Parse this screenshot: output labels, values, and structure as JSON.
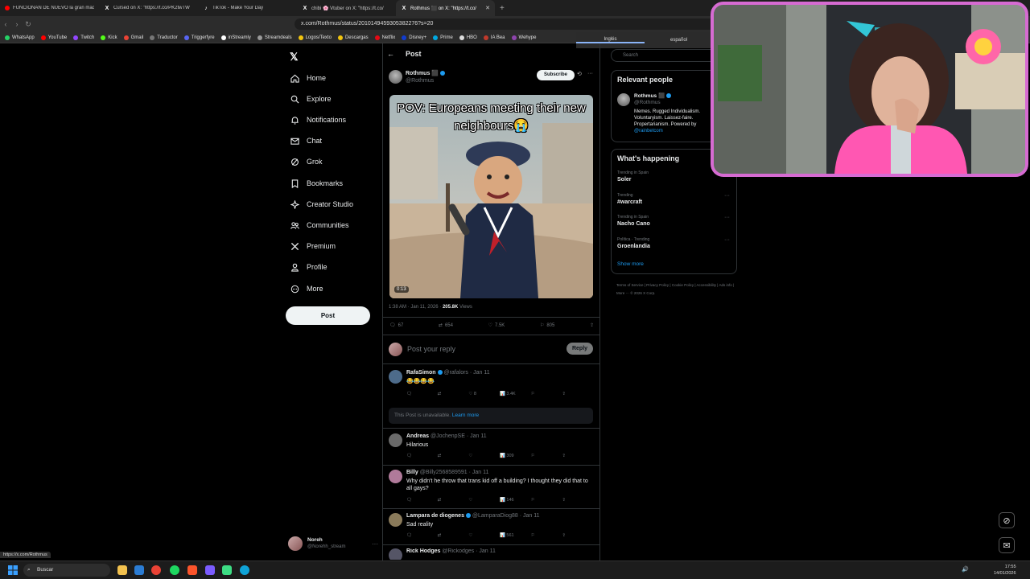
{
  "browser": {
    "tabs": [
      {
        "label": "FUNCIONAN DE NUEVO la gran maq",
        "icon": "youtube-icon",
        "active": false
      },
      {
        "label": "Cursed on X: \"https://t.co/PK2twTW",
        "icon": "x-icon",
        "active": false
      },
      {
        "label": "TikTok - Make Your Day",
        "icon": "tiktok-icon",
        "active": false
      },
      {
        "label": "chibi 🌸 Vtuber on X: \"https://t.co/",
        "icon": "x-icon",
        "active": false
      },
      {
        "label": "Rothmus ⬛ on X: \"https://t.co/",
        "icon": "x-icon",
        "active": true
      }
    ],
    "url": "x.com/Rothmus/status/2010149459305382276?s=20",
    "bookmarks": [
      "WhatsApp",
      "YouTube",
      "Twitch",
      "Kick",
      "Gmail",
      "Traductor",
      "Triggerfyre",
      "inStreamly",
      "Streamdeals",
      "Logos/Texto",
      "Descargas",
      "Netflix",
      "Disney+",
      "Prime",
      "HBO",
      "IA Bea",
      "Wehype"
    ],
    "translate": {
      "from": "Inglés",
      "to": "español"
    },
    "status_url": "https://x.com/Rothmus"
  },
  "x": {
    "logo": "𝕏",
    "nav": [
      {
        "label": "Home",
        "icon": "home-icon"
      },
      {
        "label": "Explore",
        "icon": "search-icon"
      },
      {
        "label": "Notifications",
        "icon": "bell-icon"
      },
      {
        "label": "Chat",
        "icon": "mail-icon"
      },
      {
        "label": "Grok",
        "icon": "grok-icon"
      },
      {
        "label": "Bookmarks",
        "icon": "bookmark-icon"
      },
      {
        "label": "Creator Studio",
        "icon": "creator-icon"
      },
      {
        "label": "Communities",
        "icon": "people-icon"
      },
      {
        "label": "Premium",
        "icon": "x-premium-icon"
      },
      {
        "label": "Profile",
        "icon": "person-icon"
      },
      {
        "label": "More",
        "icon": "more-icon"
      }
    ],
    "post_button": "Post",
    "account": {
      "name": "Noreh",
      "handle": "@Norehh_stream"
    }
  },
  "post": {
    "header": "Post",
    "author": {
      "name": "Rothmus ⬛",
      "handle": "@Rothmus"
    },
    "subscribe": "Subscribe",
    "video_caption": "POV: Europeans meeting their new neighbours😭",
    "duration": "0:13",
    "time": "1:38 AM · Jan 11, 2026 · ",
    "views": "205.8K",
    "views_label": " Views",
    "stats": {
      "replies": "67",
      "reposts": "654",
      "likes": "7.5K",
      "bookmarks": "805"
    },
    "reply_placeholder": "Post your reply",
    "reply_button": "Reply"
  },
  "replies": [
    {
      "name": "RafaSimon",
      "handle": "@rafalors · Jan 11",
      "text": "😂😂😂😂",
      "likes": "8",
      "views": "3.4K"
    },
    {
      "name": "Andreas",
      "handle": "@JochenpSE · Jan 11",
      "text": "Hilarious",
      "likes": "",
      "views": "309"
    },
    {
      "name": "Billy",
      "handle": "@Billy2568589591 · Jan 11",
      "text": "Why didn't he throw that trans kid off a building? I thought they did that to all gays?",
      "likes": "",
      "views": "146"
    },
    {
      "name": "Lampara de diogenes",
      "handle": "@LamparaDiog88 · Jan 11",
      "text": "Sad reality",
      "likes": "",
      "views": "561"
    },
    {
      "name": "Rick Hodges",
      "handle": "@Rickodges · Jan 11",
      "text": "",
      "likes": "",
      "views": ""
    }
  ],
  "unavailable": {
    "text": "This Post is unavailable. ",
    "link": "Learn more"
  },
  "sidebar": {
    "search_placeholder": "Search",
    "relevant_title": "Relevant people",
    "person": {
      "name": "Rothmus ⬛",
      "handle": "@Rothmus",
      "bio": "Memes. Rugged Individualism. Voluntaryism. Laissez-faire. Propertarianism. Powered by",
      "link": "@rainbetcom"
    },
    "happening_title": "What's happening",
    "trends": [
      {
        "context": "Trending in Spain",
        "topic": "Soler"
      },
      {
        "context": "Trending",
        "topic": "#warcraft"
      },
      {
        "context": "Trending in Spain",
        "topic": "Nacho Cano"
      },
      {
        "context": "Política · Trending",
        "topic": "Groenlandia"
      }
    ],
    "show_more": "Show more",
    "footer": "Terms of Service  |  Privacy Policy  |  Cookie Policy  |  Accessibility  |  Ads info  |  More ···  © 2026 X Corp."
  },
  "taskbar": {
    "search": "Buscar",
    "time": "17:55",
    "date": "14/01/2026"
  },
  "colors": {
    "accent": "#1d9bf0",
    "frame": "#d66bd2"
  }
}
